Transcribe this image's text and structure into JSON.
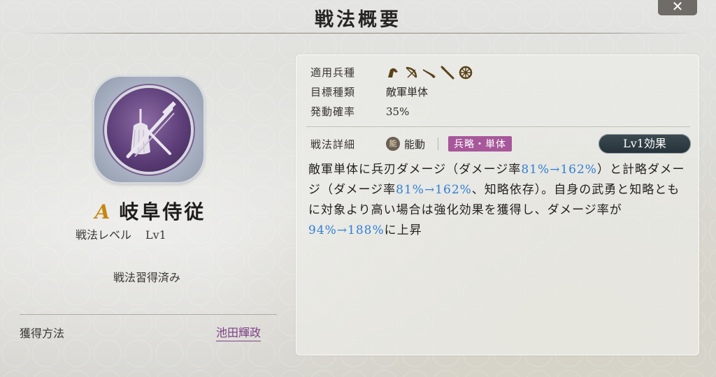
{
  "header": {
    "title": "戦法概要",
    "close_label": "✕"
  },
  "skill": {
    "grade": "A",
    "name": "岐阜侍従",
    "level_label": "戦法レベル",
    "level_value": "Lv1",
    "learned_status": "戦法習得済み",
    "emblem_icon": "tassel-and-sword-icon"
  },
  "acquire": {
    "label": "獲得方法",
    "source": "池田輝政"
  },
  "details": {
    "unit_types_label": "適用兵種",
    "unit_type_icons": [
      "cavalry-icon",
      "bow-icon",
      "gun-icon",
      "spear-icon",
      "siege-wheel-icon"
    ],
    "target_label": "目標種類",
    "target_value": "敵軍単体",
    "rate_label": "発動確率",
    "rate_value": "35%",
    "detail_label": "戦法詳細",
    "type_badge": "能",
    "type_value": "能動",
    "tag": "兵略・単体",
    "level_effect_button": "Lv1効果"
  },
  "description": {
    "p1": "敵軍単体に兵刃ダメージ（ダメージ率",
    "v1": "81%→162%",
    "p2": "）と計略ダメージ（ダメージ率",
    "v2": "81%→162%",
    "p3": "、知略依存）。自身の武勇と知略ともに対象より高い場合は強化効果を獲得し、ダメージ率が",
    "v3": "94%→188%",
    "p4": "に上昇"
  },
  "colors": {
    "accent_blue": "#2f7fd6",
    "tag_purple": "#a7579a",
    "grade_gold": "#c7860e",
    "link_purple": "#7c3e86"
  }
}
